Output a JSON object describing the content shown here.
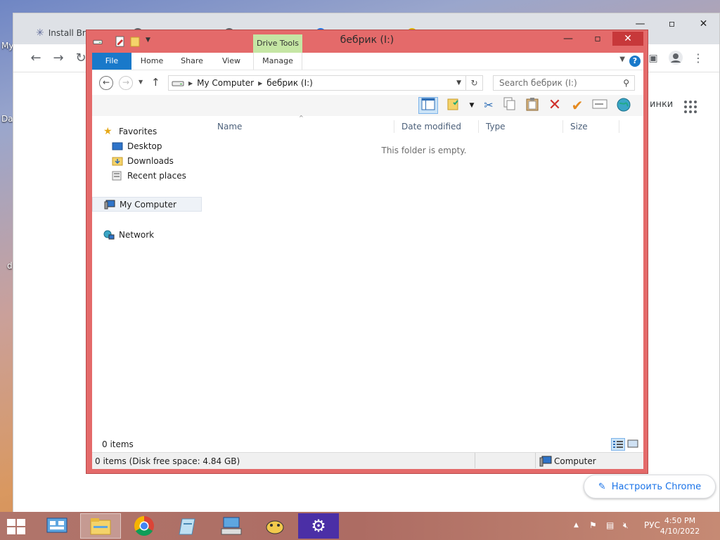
{
  "desktop": {
    "labels": [
      "My",
      "Dat",
      "d"
    ]
  },
  "chrome": {
    "tabs": [
      {
        "label": "Install Bra"
      },
      {
        "label": ""
      },
      {
        "label": ""
      },
      {
        "label": ""
      },
      {
        "label": ""
      }
    ],
    "side_text": "инки",
    "customize_label": "Настроить Chrome"
  },
  "explorer": {
    "title": "бебрик (I:)",
    "contextual_tab": "Drive Tools",
    "ribbon_tabs": {
      "file": "File",
      "home": "Home",
      "share": "Share",
      "view": "View",
      "manage": "Manage"
    },
    "help_label": "?",
    "address": {
      "segment1": "My Computer",
      "segment2": "бебрик (I:)"
    },
    "search_placeholder": "Search бебрик (I:)",
    "nav": {
      "favorites": "Favorites",
      "desktop": "Desktop",
      "downloads": "Downloads",
      "recent": "Recent places",
      "mycomputer": "My Computer",
      "network": "Network"
    },
    "columns": {
      "name": "Name",
      "date": "Date modified",
      "type": "Type",
      "size": "Size"
    },
    "empty_message": "This folder is empty.",
    "item_count": "0 items",
    "status_left": "0 items (Disk free space: 4.84 GB)",
    "status_right": "Computer"
  },
  "taskbar": {
    "language": "РУС",
    "time": "4:50 PM",
    "date": "4/10/2022"
  },
  "colors": {
    "window_frame": "#e46a6a",
    "file_tab": "#1979ca",
    "drive_tools": "#c5e6a4",
    "taskbar": "#ad6c63"
  }
}
